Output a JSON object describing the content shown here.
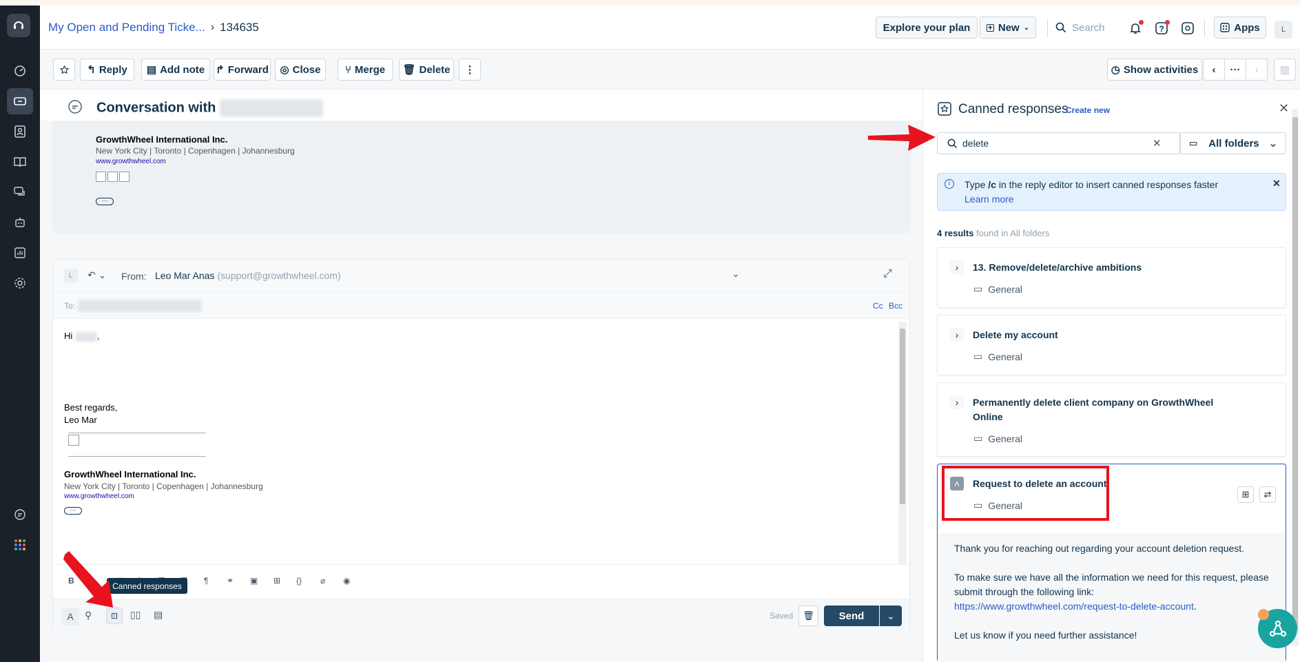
{
  "breadcrumb": {
    "parent": "My Open and Pending Ticke...",
    "current": "134635"
  },
  "header": {
    "explore_label": "Explore your plan",
    "new_label": "New",
    "search_placeholder": "Search",
    "apps_label": "Apps",
    "avatar_initial": "L"
  },
  "toolbar": {
    "reply": "Reply",
    "add_note": "Add note",
    "forward": "Forward",
    "close": "Close",
    "merge": "Merge",
    "delete": "Delete",
    "more": "⋮",
    "show_activities": "Show activities",
    "nav_more": "···"
  },
  "conversation": {
    "title": "Conversation with",
    "sig_company": "GrowthWheel International Inc.",
    "sig_cities": "New York City | Toronto | Copenhagen | Johannesburg",
    "sig_url": "www.growthwheel.com"
  },
  "reply": {
    "avatar_initial": "L",
    "from_label": "From:",
    "from_name": "Leo Mar Anas",
    "from_email": "(support@growthwheel.com)",
    "to_label": "To:",
    "cc": "Cc",
    "bcc": "Bcc",
    "greeting": "Hi",
    "greeting_end": ",",
    "closing": "Best regards,",
    "signer": "Leo Mar",
    "sig_company": "GrowthWheel International Inc.",
    "sig_cities": "New York City | Toronto | Copenhagen | Johannesburg",
    "sig_url": "www.growthwheel.com",
    "saved": "Saved",
    "send": "Send",
    "tooltip": "Canned responses"
  },
  "panel": {
    "title": "Canned responses",
    "create_new": "Create new",
    "search_value": "delete",
    "folder": "All folders",
    "info_text_1": "Type",
    "info_code": "/c",
    "info_text_2": "in the reply editor to insert canned responses faster",
    "learn_more": "Learn more",
    "results_count": "4 results",
    "results_suffix": "found in All folders",
    "items": [
      {
        "title": "13. Remove/delete/archive ambitions",
        "folder": "General"
      },
      {
        "title": "Delete my account",
        "folder": "General"
      },
      {
        "title": "Permanently delete client company on GrowthWheel",
        "title2": "Online",
        "folder": "General"
      },
      {
        "title": "Request to delete an account",
        "folder": "General"
      }
    ],
    "preview": {
      "p1": "Thank you for reaching out regarding your account deletion request.",
      "p2": "To make sure we have all the information we need for this request, please",
      "p3": "submit through the following link:",
      "link": "https://www.growthwheel.com/request-to-delete-account",
      "link_end": ".",
      "p4": "Let us know if you need further assistance!"
    }
  },
  "colors": {
    "accent": "#2c5cc5",
    "send": "#264966",
    "sidebar": "#1b2129",
    "annotation": "#e8131e"
  }
}
